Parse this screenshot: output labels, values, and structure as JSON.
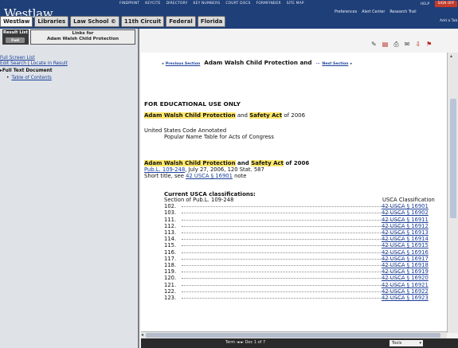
{
  "header": {
    "logo": "Westlaw",
    "top_links": [
      "FINDPRINT",
      "KEYCITE",
      "DIRECTORY",
      "KEY NUMBERS",
      "COURT DOCS",
      "FORMFINDER",
      "SITE MAP"
    ],
    "help": "HELP",
    "sign_off": "SIGN OFF",
    "right_links": [
      "Preferences",
      "Alert Center",
      "Research Trail"
    ],
    "add_tab": "Add a Tab"
  },
  "tabs": [
    "Westlaw",
    "Libraries",
    "Law School ©",
    "11th Circuit",
    "Federal",
    "Florida"
  ],
  "left_panel": {
    "result_list_label": "Result List",
    "forward_label": "Fwd",
    "links_for_label": "Links for",
    "links_for_doc": "Adam Walsh Child Protection",
    "full_screen_list": "Full Screen List",
    "edit_search": "Edit Search",
    "locate_in_result": "Locate in Result",
    "full_text_document": "Full Text Document",
    "table_of_contents": "Table of Contents"
  },
  "document": {
    "previous_section": "Previous Section",
    "next_section": "Next Section",
    "section_title": "Adam Walsh Child Protection and",
    "educational_notice": "FOR EDUCATIONAL USE ONLY",
    "title_line1_part1": "Adam Walsh Child Protection",
    "title_line1_and": " and ",
    "title_line1_part2": "Safety Act",
    "title_line1_year": " of 2006",
    "annotated": "United States Code Annotated",
    "popular_name": "Popular Name Table for Acts of Congress",
    "act_part1": "Adam Walsh Child Protection",
    "act_and": " and ",
    "act_part2": "Safety Act",
    "act_year": " of 2006",
    "pub_law_link": "Pub.L. 109-248",
    "pub_law_rest": ", July 27, 2006, 120 Stat. 587",
    "short_title_prefix": "Short title, see ",
    "short_title_link": "42 USCA § 16901",
    "short_title_suffix": " note",
    "usca_header": "Current USCA classifications:",
    "section_col_header": "Section of Pub.L. 109-248",
    "classification_col_header": "USCA Classification",
    "rows": [
      {
        "section": "102.",
        "cite": "42 USCA § 16901"
      },
      {
        "section": "103.",
        "cite": "42 USCA § 16902"
      },
      {
        "section": "111.",
        "cite": "42 USCA § 16911"
      },
      {
        "section": "112.",
        "cite": "42 USCA § 16912"
      },
      {
        "section": "113.",
        "cite": "42 USCA § 16913"
      },
      {
        "section": "114.",
        "cite": "42 USCA § 16914"
      },
      {
        "section": "115.",
        "cite": "42 USCA § 16915"
      },
      {
        "section": "116.",
        "cite": "42 USCA § 16916"
      },
      {
        "section": "117.",
        "cite": "42 USCA § 16917"
      },
      {
        "section": "118.",
        "cite": "42 USCA § 16918"
      },
      {
        "section": "119.",
        "cite": "42 USCA § 16919"
      },
      {
        "section": "120.",
        "cite": "42 USCA § 16920"
      },
      {
        "section": "121.",
        "cite": "42 USCA § 16921"
      },
      {
        "section": "122.",
        "cite": "42 USCA § 16922"
      },
      {
        "section": "123.",
        "cite": "42 USCA § 16923"
      }
    ]
  },
  "bottom_bar": {
    "pager": "Term ◄ ► Doc 1 of 7",
    "tools": "Tools"
  },
  "colors": {
    "header_bg": "#1f3f78",
    "link": "#1b3f9a",
    "highlight": "#ffe86b",
    "sign_off": "#c23b2a"
  }
}
